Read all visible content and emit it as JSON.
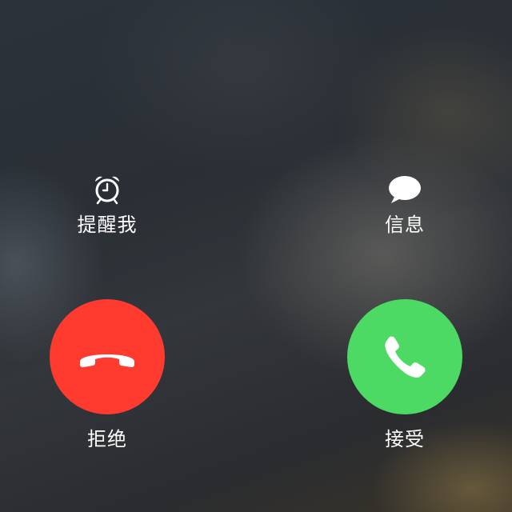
{
  "remind": {
    "label": "提醒我",
    "icon": "alarm-clock-icon"
  },
  "message": {
    "label": "信息",
    "icon": "speech-bubble-icon"
  },
  "decline": {
    "label": "拒绝",
    "icon": "phone-hangup-icon",
    "color": "#ff3b30"
  },
  "accept": {
    "label": "接受",
    "icon": "phone-icon",
    "color": "#4cd964"
  }
}
